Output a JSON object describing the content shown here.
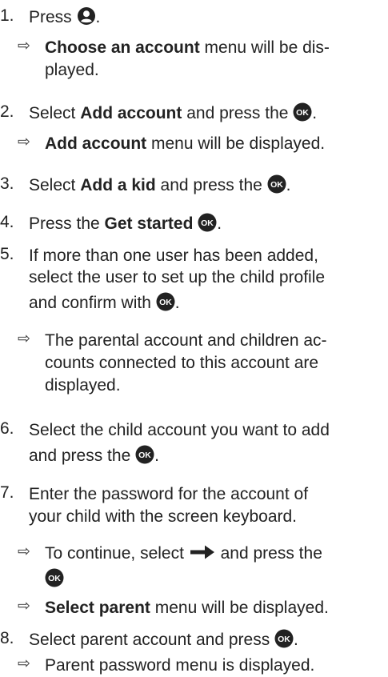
{
  "icons": {
    "ok": "ok-button-icon",
    "user": "user-account-icon",
    "right": "right-arrow-icon"
  },
  "s1": {
    "num": "1.",
    "pre": "Press",
    "post": "."
  },
  "r1": {
    "arrow": "⇨",
    "bold": "Choose an account",
    "rest1": " menu will be dis-",
    "rest2": "played."
  },
  "s2": {
    "num": "2.",
    "pre": "Select ",
    "bold": "Add account",
    "mid": " and press the ",
    "post": "."
  },
  "r2": {
    "arrow": "⇨",
    "bold": "Add account",
    "rest": " menu will be displayed."
  },
  "s3": {
    "num": "3.",
    "pre": "Select ",
    "bold": "Add a kid",
    "mid": " and press the ",
    "post": "."
  },
  "s4": {
    "num": "4.",
    "pre": "Press the ",
    "bold": "Get started",
    "post": "."
  },
  "s5": {
    "num": "5.",
    "line1": "If more than one user has been added,",
    "line2": "select the user to set up the child profile",
    "line3": "and confirm with ",
    "post": "."
  },
  "r5": {
    "arrow": "⇨",
    "line1": "The parental account and children ac-",
    "line2": "counts connected to this account are",
    "line3": "displayed."
  },
  "s6": {
    "num": "6.",
    "line1": "Select the child account you want to add",
    "line2": "and press the ",
    "post": "."
  },
  "s7": {
    "num": "7.",
    "line1": "Enter the password for the account of",
    "line2": "your child with the screen keyboard."
  },
  "r7a": {
    "arrow": "⇨",
    "pre": "To continue, select ",
    "mid": " and press the"
  },
  "r7b": {
    "arrow": "⇨",
    "bold": "Select parent",
    "rest": " menu will be displayed."
  },
  "s8": {
    "num": "8.",
    "pre": "Select parent account and press ",
    "post": "."
  },
  "r8": {
    "arrow": "⇨",
    "rest": "Parent password menu is displayed."
  }
}
